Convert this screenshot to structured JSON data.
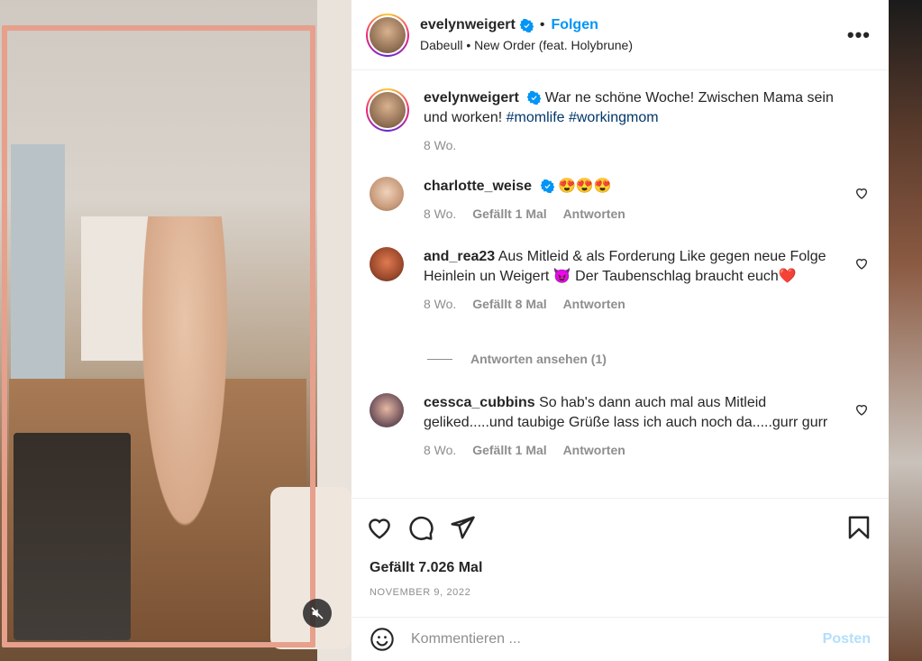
{
  "colors": {
    "accent": "#0095f6",
    "hashtag": "#00376b",
    "muted": "#8e8e8e",
    "text": "#262626",
    "heart_emoji": "#e0245e"
  },
  "header": {
    "username": "evelynweigert",
    "separator": "•",
    "follow_label": "Folgen",
    "audio": "Dabeull • New Order (feat. Holybrune)",
    "more_label": "•••"
  },
  "caption": {
    "username": "evelynweigert",
    "text_before": "War ne schöne Woche! Zwischen Mama sein und worken!",
    "hashtags": "#momlife #workingmom",
    "time": "8 Wo."
  },
  "comments": [
    {
      "username": "charlotte_weise",
      "verified": true,
      "text": "😍😍😍",
      "time": "8 Wo.",
      "likes": "Gefällt 1 Mal",
      "reply": "Antworten"
    },
    {
      "username": "and_rea23",
      "verified": false,
      "text": "Aus Mitleid & als Forderung Like gegen neue Folge Heinlein un Weigert 😈 Der Taubenschlag braucht euch❤️",
      "time": "8 Wo.",
      "likes": "Gefällt 8 Mal",
      "reply": "Antworten"
    },
    {
      "username": "cessca_cubbins",
      "verified": false,
      "text": "So hab's dann auch mal aus Mitleid geliked.....und taubige Grüße lass ich auch noch da.....gurr gurr",
      "time": "8 Wo.",
      "likes": "Gefällt 1 Mal",
      "reply": "Antworten"
    }
  ],
  "view_replies_label": "Antworten ansehen (1)",
  "actions": {
    "icons": [
      "heart-icon",
      "comment-icon",
      "share-icon",
      "bookmark-icon"
    ],
    "likes_label": "Gefällt 7.026 Mal",
    "date": "NOVEMBER 9, 2022"
  },
  "comment_box": {
    "placeholder": "Kommentieren ...",
    "post_label": "Posten"
  },
  "media": {
    "mute_icon": "speaker-muted-icon"
  }
}
